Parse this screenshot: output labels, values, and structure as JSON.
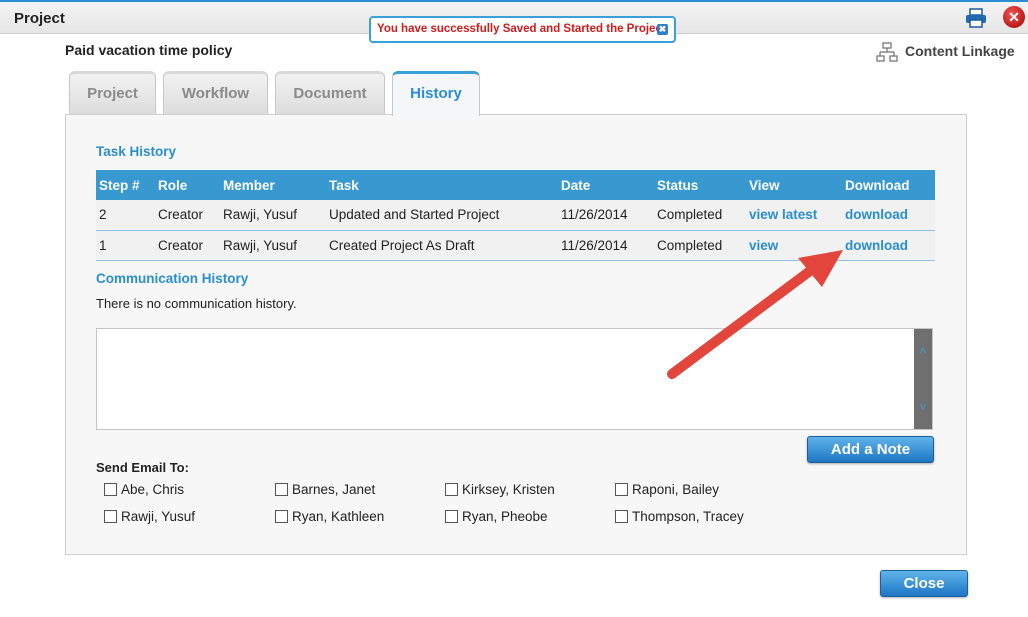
{
  "window": {
    "title": "Project"
  },
  "toast": {
    "message": "You have successfully Saved and Started the Project",
    "close_icon": "✖"
  },
  "icons": {
    "print": "printer-icon",
    "close": "close-circle-icon",
    "linkage": "sitemap-icon"
  },
  "close_x_glyph": "✕",
  "header": {
    "doc_title": "Paid vacation time policy",
    "linkage_label": "Content Linkage"
  },
  "tabs": [
    {
      "label": "Project"
    },
    {
      "label": "Workflow"
    },
    {
      "label": "Document"
    },
    {
      "label": "History",
      "active": true
    }
  ],
  "task_history": {
    "title": "Task History",
    "columns": [
      "Step #",
      "Role",
      "Member",
      "Task",
      "Date",
      "Status",
      "View",
      "Download"
    ],
    "rows": [
      {
        "step": "2",
        "role": "Creator",
        "member": "Rawji, Yusuf",
        "task": "Updated and Started Project",
        "date": "11/26/2014",
        "status": "Completed",
        "view": "view latest",
        "download": "download"
      },
      {
        "step": "1",
        "role": "Creator",
        "member": "Rawji, Yusuf",
        "task": "Created Project As Draft",
        "date": "11/26/2014",
        "status": "Completed",
        "view": "view",
        "download": "download"
      }
    ]
  },
  "communication": {
    "title": "Communication History",
    "empty_text": "There is no communication history.",
    "scroll_up": "˄",
    "scroll_down": "˅"
  },
  "buttons": {
    "add_note": "Add a Note",
    "close": "Close"
  },
  "email": {
    "label": "Send Email To:",
    "recipients": [
      {
        "name": "Abe, Chris",
        "checked": false
      },
      {
        "name": "Barnes, Janet",
        "checked": false
      },
      {
        "name": "Kirksey, Kristen",
        "checked": false
      },
      {
        "name": "Raponi, Bailey",
        "checked": false
      },
      {
        "name": "Rawji, Yusuf",
        "checked": false
      },
      {
        "name": "Ryan, Kathleen",
        "checked": false
      },
      {
        "name": "Ryan, Pheobe",
        "checked": false
      },
      {
        "name": "Thompson, Tracey",
        "checked": false
      }
    ]
  },
  "colors": {
    "accent": "#2a8fd0",
    "toast_text": "#d21a1a",
    "arrow": "#e2453b"
  }
}
